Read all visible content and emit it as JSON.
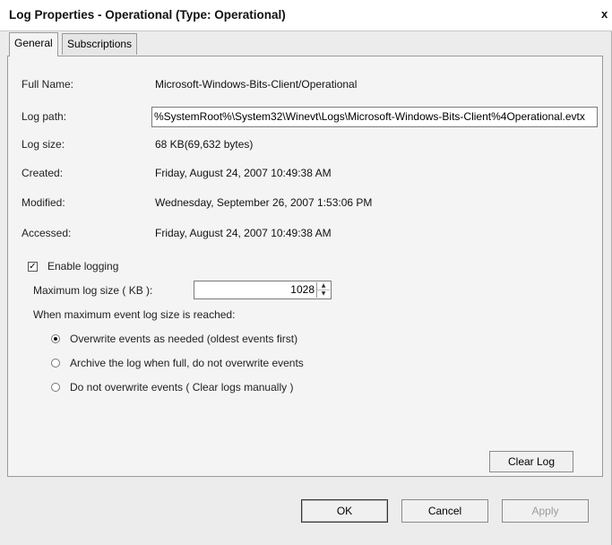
{
  "window": {
    "title": "Log Properties - Operational (Type: Operational)",
    "close_label": "x"
  },
  "tabs": [
    {
      "label": "General",
      "active": true
    },
    {
      "label": "Subscriptions",
      "active": false
    }
  ],
  "general": {
    "full_name_label": "Full Name:",
    "full_name_value": "Microsoft-Windows-Bits-Client/Operational",
    "log_path_label": "Log path:",
    "log_path_value": "%SystemRoot%\\System32\\Winevt\\Logs\\Microsoft-Windows-Bits-Client%4Operational.evtx",
    "log_size_label": "Log size:",
    "log_size_value": "68 KB(69,632 bytes)",
    "created_label": "Created:",
    "created_value": "Friday, August 24, 2007 10:49:38 AM",
    "modified_label": "Modified:",
    "modified_value": "Wednesday, September 26, 2007 1:53:06 PM",
    "accessed_label": "Accessed:",
    "accessed_value": "Friday, August 24, 2007 10:49:38 AM",
    "enable_logging_label": "Enable logging",
    "enable_logging_checked": true,
    "max_size_label": "Maximum log size ( KB ):",
    "max_size_value": "1028",
    "when_reached_label": "When maximum event log size is reached:",
    "options": [
      {
        "label": "Overwrite events as needed (oldest events first)",
        "selected": true
      },
      {
        "label": "Archive the log when full, do not overwrite events",
        "selected": false
      },
      {
        "label": "Do not overwrite events ( Clear logs manually )",
        "selected": false
      }
    ],
    "clear_log_label": "Clear Log"
  },
  "footer": {
    "ok_label": "OK",
    "cancel_label": "Cancel",
    "apply_label": "Apply"
  }
}
